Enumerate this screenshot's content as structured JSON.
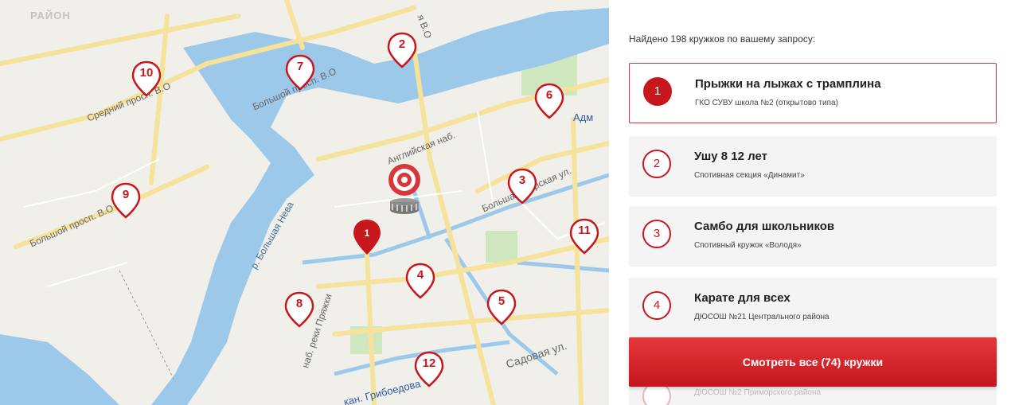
{
  "map": {
    "district_label": "РАЙОН",
    "place_label": "Адм",
    "streets": [
      {
        "id": "sredniy",
        "text": "Средний просп. В.О"
      },
      {
        "id": "bolshoy-top",
        "text": "Большой просп. В.О"
      },
      {
        "id": "line-vo",
        "text": "я В.О"
      },
      {
        "id": "angl",
        "text": "Английская наб."
      },
      {
        "id": "bolshoy-left",
        "text": "Большой просп. В.О"
      },
      {
        "id": "neva",
        "text": "р. Большая Нева"
      },
      {
        "id": "morskaya",
        "text": "Большая Морская ул."
      },
      {
        "id": "pryazhki",
        "text": "наб. реки Пряжки"
      },
      {
        "id": "sadovaya",
        "text": "Садовая ул."
      },
      {
        "id": "griboedova",
        "text": "кан. Грибоедова"
      }
    ],
    "markers": [
      {
        "label": "1",
        "filled": true
      },
      {
        "label": "2"
      },
      {
        "label": "3"
      },
      {
        "label": "4"
      },
      {
        "label": "5"
      },
      {
        "label": "6"
      },
      {
        "label": "7"
      },
      {
        "label": "8"
      },
      {
        "label": "9"
      },
      {
        "label": "10"
      },
      {
        "label": "11"
      },
      {
        "label": "12"
      }
    ],
    "icons": [
      "target-icon",
      "coin-stack-icon"
    ],
    "colors": {
      "water": "#9cc9ea",
      "road": "#f6e29a",
      "park": "#cfe7bf",
      "land": "#f0efe9",
      "accent": "#c8161d"
    }
  },
  "panel": {
    "results_text": "Найдено 198 кружков по вашему запросу:",
    "cards": [
      {
        "num": "1",
        "title": "Прыжки на лыжах с трамплина",
        "subtitle": "ГКО СУВУ школа №2 (открытово типа)"
      },
      {
        "num": "2",
        "title": "Ушу 8 12 лет",
        "subtitle": "Спотивная секция «Динамит»"
      },
      {
        "num": "3",
        "title": "Самбо для школьников",
        "subtitle": "Спотивный кружок «Володя»"
      },
      {
        "num": "4",
        "title": "Карате для всех",
        "subtitle": "ДЮСОШ №21 Центрального района"
      }
    ],
    "next_subtitle": "ДЮСОШ №2 Приморского района",
    "cta_label": "Смотреть все (74) кружки"
  }
}
